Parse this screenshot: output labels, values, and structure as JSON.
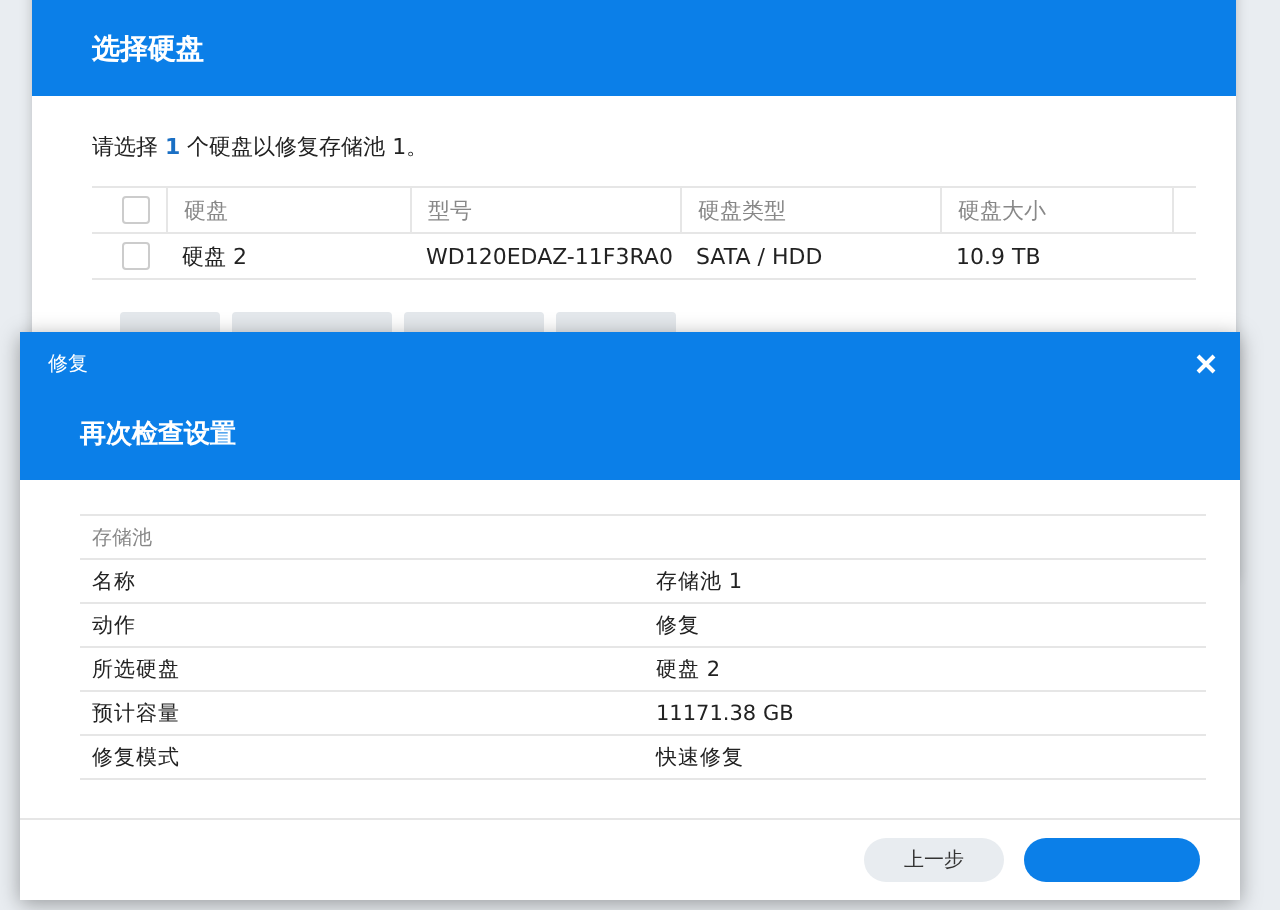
{
  "back_dialog": {
    "title": "选择硬盘",
    "instruction": "请选择 **1** 个硬盘以修复存储池 1。",
    "table": {
      "header_checked": false,
      "columns": [
        "硬盘",
        "型号",
        "硬盘类型",
        "硬盘大小"
      ],
      "rows": [
        {
          "checked": false,
          "cells": [
            "硬盘 2",
            "WD120EDAZ-11F3RA0",
            "SATA / HDD",
            "10.9 TB"
          ]
        }
      ]
    }
  },
  "front_dialog": {
    "window_title": "修复",
    "heading": "再次检查设置",
    "section": "存储池",
    "rows": [
      {
        "label": "名称",
        "value": "存储池 1"
      },
      {
        "label": "动作",
        "value": "修复"
      },
      {
        "label": "所选硬盘",
        "value": "硬盘 2"
      },
      {
        "label": "预计容量",
        "value": "11171.38 GB"
      },
      {
        "label": "修复模式",
        "value": "快速修复"
      }
    ],
    "buttons": [
      {
        "kind": "secondary",
        "label": "上一步"
      },
      {
        "kind": "primary"
      }
    ]
  }
}
